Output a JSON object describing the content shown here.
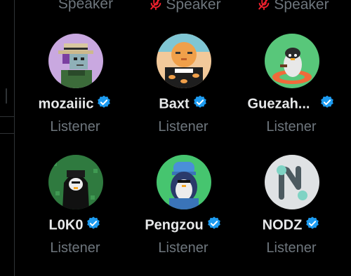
{
  "colors": {
    "background": "#000000",
    "name_text": "#e7e9ea",
    "role_text": "#6e767d",
    "verified_badge": "#1d9bf0",
    "mic_off": "#f4212e"
  },
  "top_row": [
    {
      "role": "Speaker",
      "mic_muted": false
    },
    {
      "role": "Speaker",
      "mic_muted": true,
      "icon": "mic-off-icon"
    },
    {
      "role": "Speaker",
      "mic_muted": true,
      "icon": "mic-off-icon"
    }
  ],
  "participants": [
    {
      "name": "mozaiiic",
      "verified": true,
      "role": "Listener",
      "avatar": "pixel-character-avatar"
    },
    {
      "name": "Baxt",
      "verified": true,
      "role": "Listener",
      "avatar": "orange-cat-avatar"
    },
    {
      "name": "Guezah...",
      "verified": true,
      "role": "Listener",
      "avatar": "penguin-float-avatar"
    },
    {
      "name": "L0K0",
      "verified": true,
      "role": "Listener",
      "avatar": "hooded-penguin-avatar"
    },
    {
      "name": "Pengzou",
      "verified": true,
      "role": "Listener",
      "avatar": "beanie-penguin-avatar"
    },
    {
      "name": "NODZ",
      "verified": true,
      "role": "Listener",
      "avatar": "n-logo-avatar"
    }
  ]
}
